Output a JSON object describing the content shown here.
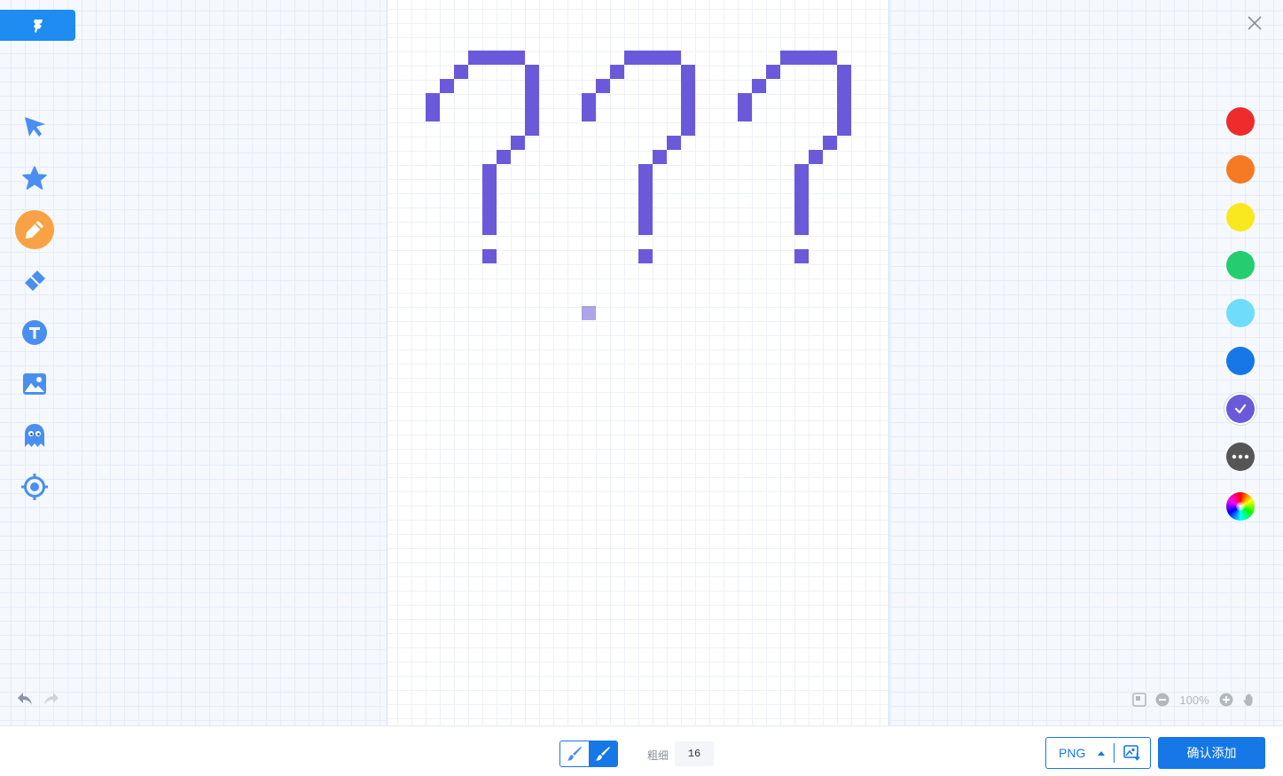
{
  "toolbar": {
    "tools": [
      {
        "name": "select",
        "icon": "cursor-arrow-icon"
      },
      {
        "name": "shape",
        "icon": "star-icon"
      },
      {
        "name": "pen",
        "icon": "pencil-icon",
        "active": true
      },
      {
        "name": "eraser",
        "icon": "eraser-icon"
      },
      {
        "name": "text",
        "icon": "text-t-icon"
      },
      {
        "name": "image",
        "icon": "image-icon"
      },
      {
        "name": "sticker",
        "icon": "ghost-icon"
      },
      {
        "name": "locate",
        "icon": "crosshair-icon"
      }
    ],
    "active_color": "#f9a245",
    "icon_color": "#4a8ff0"
  },
  "palette": {
    "colors": [
      "#ef2b2b",
      "#f57a23",
      "#fae81f",
      "#23cd70",
      "#6fdcfb",
      "#1677e6",
      "#6a5ad9",
      "#555555",
      "conic"
    ],
    "selected": "#6a5ad9",
    "more_icon": "more-dots-icon",
    "picker_icon": "color-wheel-icon"
  },
  "canvas": {
    "stroke_color": "#6a5ad9",
    "drawing": "three pixel question marks"
  },
  "zoom": {
    "level": "100%"
  },
  "bottom": {
    "size_label": "粗细",
    "size_value": "16",
    "format": "PNG",
    "confirm_label": "确认添加"
  }
}
